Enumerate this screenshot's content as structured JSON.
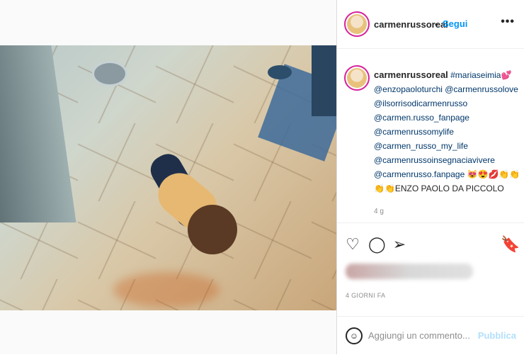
{
  "post": {
    "username": "carmenrussoreal",
    "follow_label": "Segui",
    "dot": "•",
    "more_icon": "more-horizontal-icon",
    "caption_hashtag": "#mariaseimia",
    "caption_lines": [
      "@enzopaoloturchi @carmenrussolove",
      "@ilsorrisodicarmenrusso",
      "@carmen.russo_fanpage",
      "@carmenrussomylife",
      "@carmen_russo_my_life",
      "@carmenrussoinsegnaciavivere",
      "@carmenrusso.fanpage 😻😍💋👏👏"
    ],
    "caption_last": "👏👏ENZO PAOLO DA PICCOLO",
    "age": "4 g",
    "date": "4 GIORNI FA"
  },
  "actions": {
    "like_icon": "heart-icon",
    "comment_icon": "comment-icon",
    "share_icon": "share-icon",
    "save_icon": "bookmark-icon"
  },
  "comment_box": {
    "placeholder": "Aggiungi un commento...",
    "publish_label": "Pubblica",
    "emoji_icon": "emoji-icon"
  }
}
